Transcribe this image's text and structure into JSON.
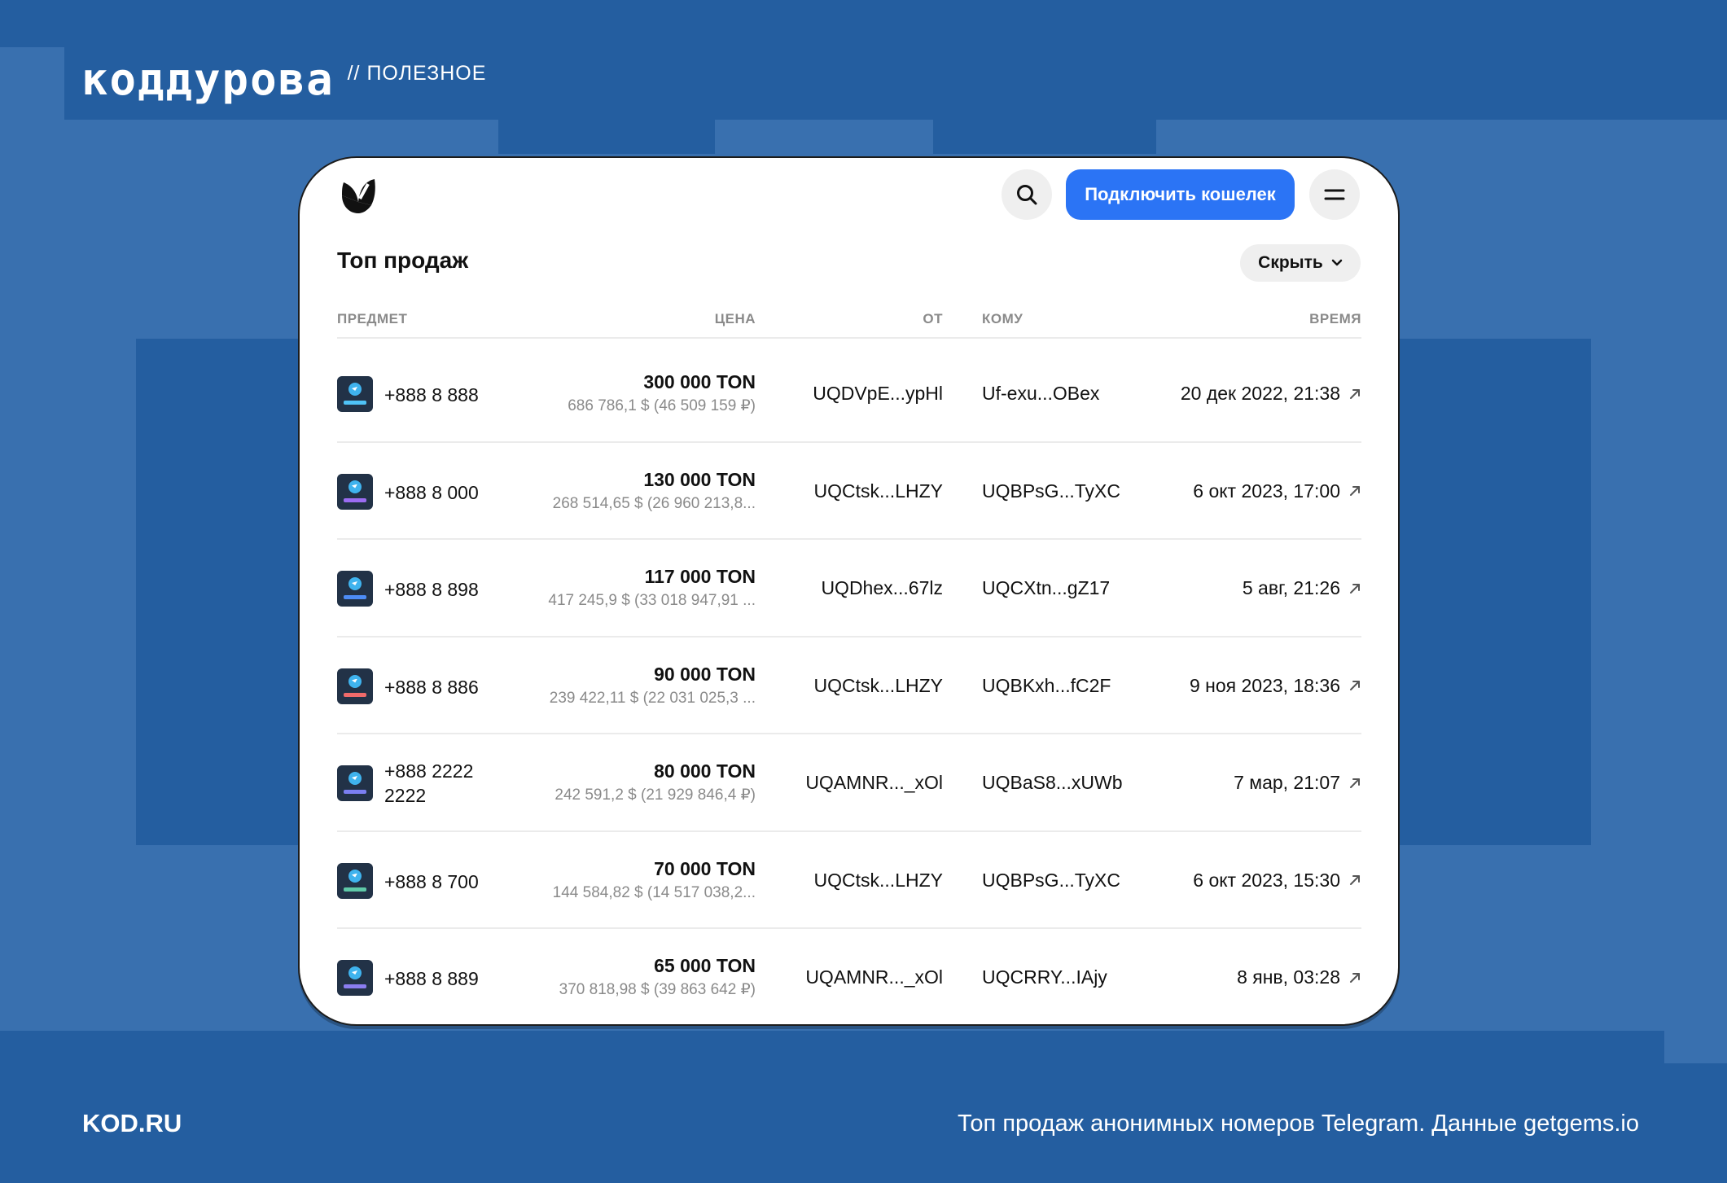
{
  "brand": {
    "logo_text": "КОДДУРОВА",
    "section": "// ПОЛЕЗНОЕ"
  },
  "app": {
    "connect_label": "Подключить кошелек",
    "section_title": "Топ продаж",
    "hide_label": "Скрыть"
  },
  "table": {
    "headers": {
      "item": "ПРЕДМЕТ",
      "price": "ЦЕНА",
      "from": "ОТ",
      "to": "КОМУ",
      "time": "ВРЕМЯ"
    },
    "rows": [
      {
        "name": "+888 8 888",
        "plate_color": "#4fc3f7",
        "ton": "300 000 TON",
        "fiat": "686 786,1 $ (46 509 159 ₽)",
        "from": "UQDVpE...ypHl",
        "to": "Uf-exu...OBex",
        "time": "20 дек 2022, 21:38"
      },
      {
        "name": "+888 8 000",
        "plate_color": "#9b6cf2",
        "ton": "130 000 TON",
        "fiat": "268 514,65 $ (26 960 213,8...",
        "from": "UQCtsk...LHZY",
        "to": "UQBPsG...TyXC",
        "time": "6 окт 2023, 17:00"
      },
      {
        "name": "+888 8 898",
        "plate_color": "#4d8cf5",
        "ton": "117 000 TON",
        "fiat": "417 245,9 $ (33 018 947,91 ...",
        "from": "UQDhex...67lz",
        "to": "UQCXtn...gZ17",
        "time": "5 авг, 21:26"
      },
      {
        "name": "+888 8 886",
        "plate_color": "#f06a6a",
        "ton": "90 000 TON",
        "fiat": "239 422,11 $ (22 031 025,3 ...",
        "from": "UQCtsk...LHZY",
        "to": "UQBKxh...fC2F",
        "time": "9 ноя 2023, 18:36"
      },
      {
        "name": "+888 2222 2222",
        "plate_color": "#7b7ff2",
        "ton": "80 000 TON",
        "fiat": "242 591,2 $ (21 929 846,4 ₽)",
        "from": "UQAMNR..._xOl",
        "to": "UQBaS8...xUWb",
        "time": "7 мар, 21:07"
      },
      {
        "name": "+888 8 700",
        "plate_color": "#5fc9a8",
        "ton": "70 000 TON",
        "fiat": "144 584,82 $ (14 517 038,2...",
        "from": "UQCtsk...LHZY",
        "to": "UQBPsG...TyXC",
        "time": "6 окт 2023, 15:30"
      },
      {
        "name": "+888 8 889",
        "plate_color": "#8a7df0",
        "ton": "65 000 TON",
        "fiat": "370 818,98 $ (39 863 642 ₽)",
        "from": "UQAMNR..._xOl",
        "to": "UQCRRY...IAjy",
        "time": "8 янв, 03:28"
      }
    ]
  },
  "footer": {
    "left": "KOD.RU",
    "right": "Топ продаж анонимных номеров Telegram. Данные getgems.io"
  },
  "icons": {
    "site_logo": "getgems-logo-icon",
    "search": "search-icon",
    "menu": "menu-icon",
    "chevron": "chevron-down-icon",
    "external": "external-link-arrow-icon",
    "thumb": "telegram-number-icon"
  },
  "colors": {
    "background": "#245ea0",
    "accent": "#2b74f5"
  }
}
